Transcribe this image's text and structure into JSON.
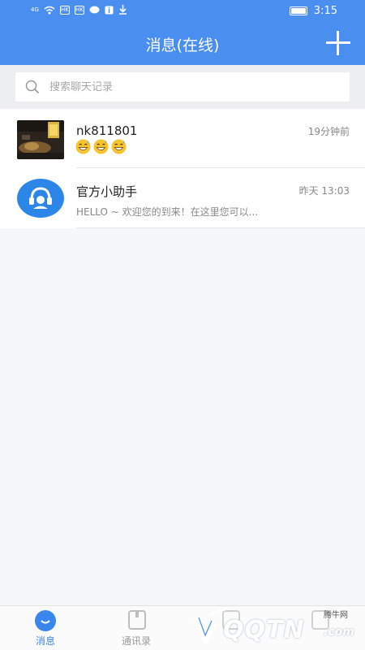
{
  "status_bar": {
    "network": "4G",
    "hk1": "HK",
    "hk2": "HK",
    "time": "3:15"
  },
  "header": {
    "title": "消息(在线)",
    "add_icon": "plus-icon"
  },
  "search": {
    "placeholder": "搜索聊天记录"
  },
  "conversations": [
    {
      "name": "nk811801",
      "time": "19分钟前",
      "preview_emojis": [
        "grinning-sweat-emoji",
        "grinning-sweat-emoji",
        "grinning-sweat-emoji"
      ],
      "avatar": "photo"
    },
    {
      "name": "官方小助手",
      "time": "昨天 13:03",
      "preview": "HELLO ~ 欢迎您的到来！在这里您可以...",
      "avatar": "headset-icon"
    }
  ],
  "bottom_nav": [
    {
      "label": "消息",
      "icon": "chat-icon",
      "active": true
    },
    {
      "label": "通讯录",
      "icon": "contacts-icon",
      "active": false
    },
    {
      "label": "",
      "icon": "discover-icon",
      "active": false
    },
    {
      "label": "",
      "icon": "profile-icon",
      "active": false
    }
  ],
  "watermark": {
    "site": "腾牛网",
    "brand": "QQTN",
    "domain": ".com"
  },
  "colors": {
    "primary": "#4a8ef0",
    "avatar_blue": "#2b86e8",
    "active_tab": "#3a86ef"
  }
}
